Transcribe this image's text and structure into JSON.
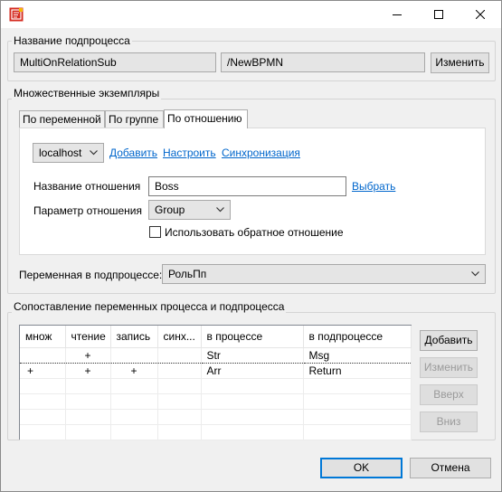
{
  "window": {
    "title": ""
  },
  "subprocess_group": {
    "title": "Название подпроцесса",
    "name_value": "MultiOnRelationSub",
    "path_value": "/NewBPMN",
    "change_button": "Изменить"
  },
  "multi_group": {
    "title": "Множественные экземпляры",
    "tabs": [
      "По переменной",
      "По группе",
      "По отношению"
    ],
    "active_tab": 2,
    "server_select": "localhost",
    "add_link": "Добавить",
    "configure_link": "Настроить",
    "sync_link": "Синхронизация",
    "relation_name_label": "Название отношения",
    "relation_name_value": "Boss",
    "choose_link": "Выбрать",
    "relation_param_label": "Параметр отношения",
    "relation_param_value": "Group",
    "inverse_checkbox_label": "Использовать обратное отношение",
    "inverse_checked": false,
    "subprocess_var_label": "Переменная в подпроцессе:",
    "subprocess_var_value": "РольПп"
  },
  "mapping_group": {
    "title": "Сопоставление переменных процесса и подпроцесса",
    "columns": [
      "множ",
      "чтение",
      "запись",
      "синх...",
      "в процессе",
      "в подпроцессе"
    ],
    "rows": [
      [
        "",
        "+",
        "",
        "",
        "Str",
        "Msg"
      ],
      [
        "+",
        "+",
        "+",
        "",
        "Arr",
        "Return"
      ],
      [
        "",
        "",
        "",
        "",
        "",
        ""
      ],
      [
        "",
        "",
        "",
        "",
        "",
        ""
      ],
      [
        "",
        "",
        "",
        "",
        "",
        ""
      ],
      [
        "",
        "",
        "",
        "",
        "",
        ""
      ]
    ],
    "buttons": {
      "add": "Добавить",
      "edit": "Изменить",
      "up": "Вверх",
      "down": "Вниз"
    }
  },
  "footer": {
    "ok": "OK",
    "cancel": "Отмена"
  }
}
